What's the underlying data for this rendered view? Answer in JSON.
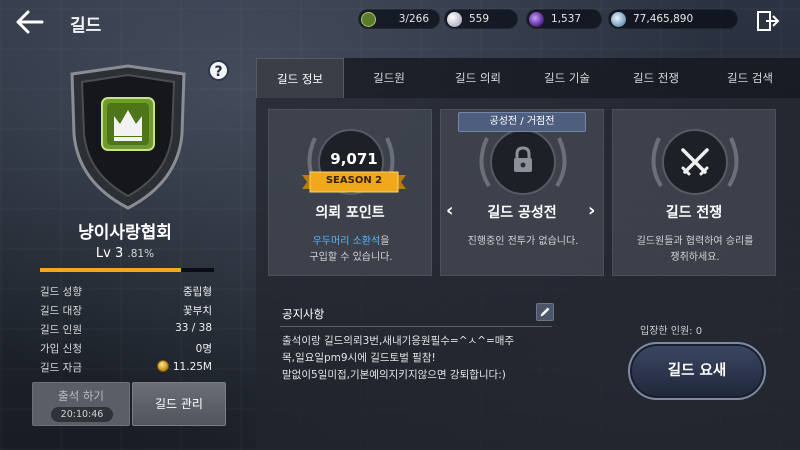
{
  "header": {
    "title": "길드",
    "resources": [
      {
        "icon": "guild-member-icon",
        "value": "3/266"
      },
      {
        "icon": "pearl-icon",
        "value": "559"
      },
      {
        "icon": "purple-gem-icon",
        "value": "1,537"
      },
      {
        "icon": "silver-coin-icon",
        "value": "77,465,890"
      }
    ]
  },
  "guild": {
    "name": "냥이사랑협회",
    "level_text": "Lv 3",
    "level_pct": ".81%",
    "xp_fraction": 0.81,
    "emblem_icon": "crown-icon",
    "info": [
      {
        "key": "길드 성향",
        "value": "중립형"
      },
      {
        "key": "길드 대장",
        "value": "꽃부치"
      },
      {
        "key": "길드 인원",
        "value": "33 / 38"
      },
      {
        "key": "가입 신청",
        "value": "0명"
      },
      {
        "key": "길드 자금",
        "value": "11.25M"
      }
    ]
  },
  "buttons": {
    "attend_label": "출석 하기",
    "attend_timer": "20:10:46",
    "manage_label": "길드 관리",
    "request_label": "길드 요새"
  },
  "tabs": [
    "길드 정보",
    "길드원",
    "길드 의뢰",
    "길드 기술",
    "길드 전쟁",
    "길드 검색"
  ],
  "active_tab": 0,
  "cards": {
    "points": {
      "value": "9,071",
      "season": "SEASON 2",
      "title": "의뢰 포인트",
      "desc_link": "우두머리 소환석",
      "desc_suffix": "을",
      "desc_line2": "구입할 수 있습니다."
    },
    "siege": {
      "tag": "공성전 / 거점전",
      "title": "길드 공성전",
      "desc": "진행중인 전투가 없습니다."
    },
    "war": {
      "title": "길드 전쟁",
      "desc_line1": "길드원들과 협력하여 승리를",
      "desc_line2": "쟁취하세요."
    }
  },
  "notice": {
    "title": "공지사항",
    "lines": [
      "출석이랑 길드의뢰3번,새내기응원필수=^ㅅ^=매주",
      "목,일요일pm9시에 길드토벌 필참!",
      "말없이5일미접,기본예의지키지않으면 강퇴합니다:)"
    ]
  },
  "joined_text": "입장한 인원: 0",
  "colors": {
    "accent_gold": "#f0a81c",
    "link_blue": "#5bb8ff"
  }
}
